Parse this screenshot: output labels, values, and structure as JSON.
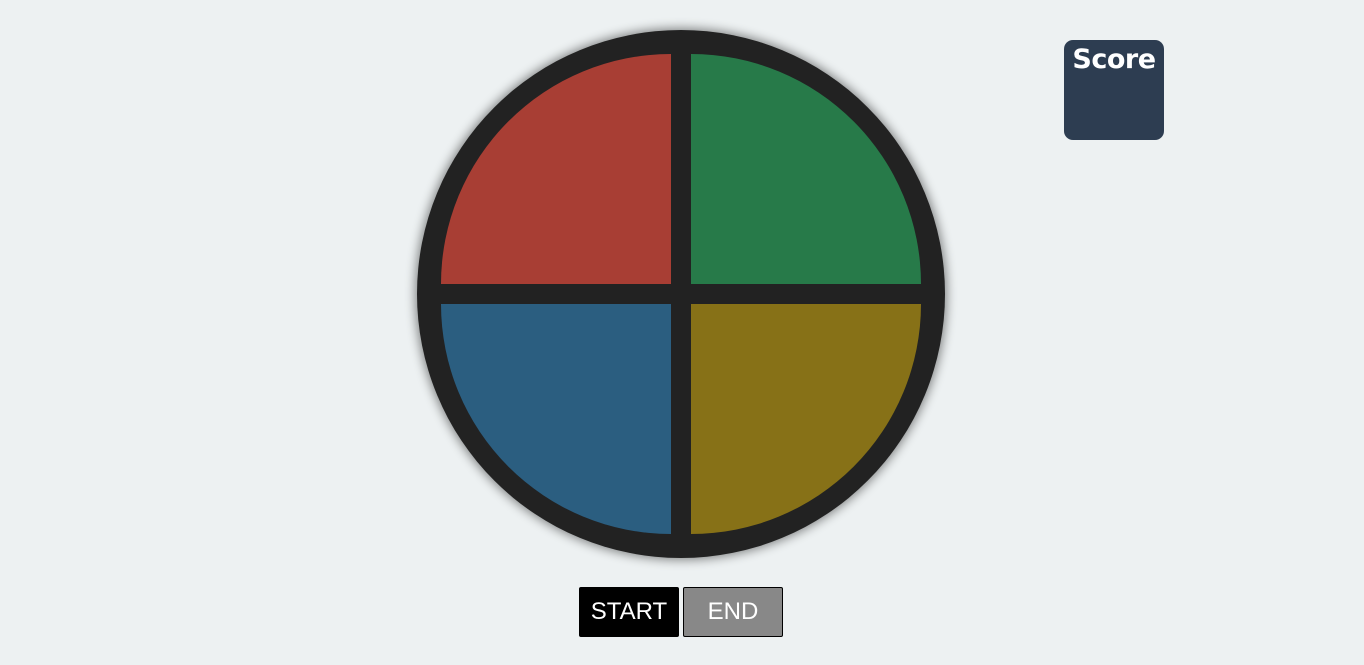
{
  "game": {
    "pads": [
      {
        "id": "red",
        "color": "#a83e34"
      },
      {
        "id": "green",
        "color": "#277a49"
      },
      {
        "id": "blue",
        "color": "#2b5e80"
      },
      {
        "id": "yellow",
        "color": "#877117"
      }
    ],
    "board_color": "#222222"
  },
  "score": {
    "label": "Score",
    "value": "",
    "background": "#2d3d51"
  },
  "controls": {
    "start_label": "START",
    "end_label": "END"
  }
}
